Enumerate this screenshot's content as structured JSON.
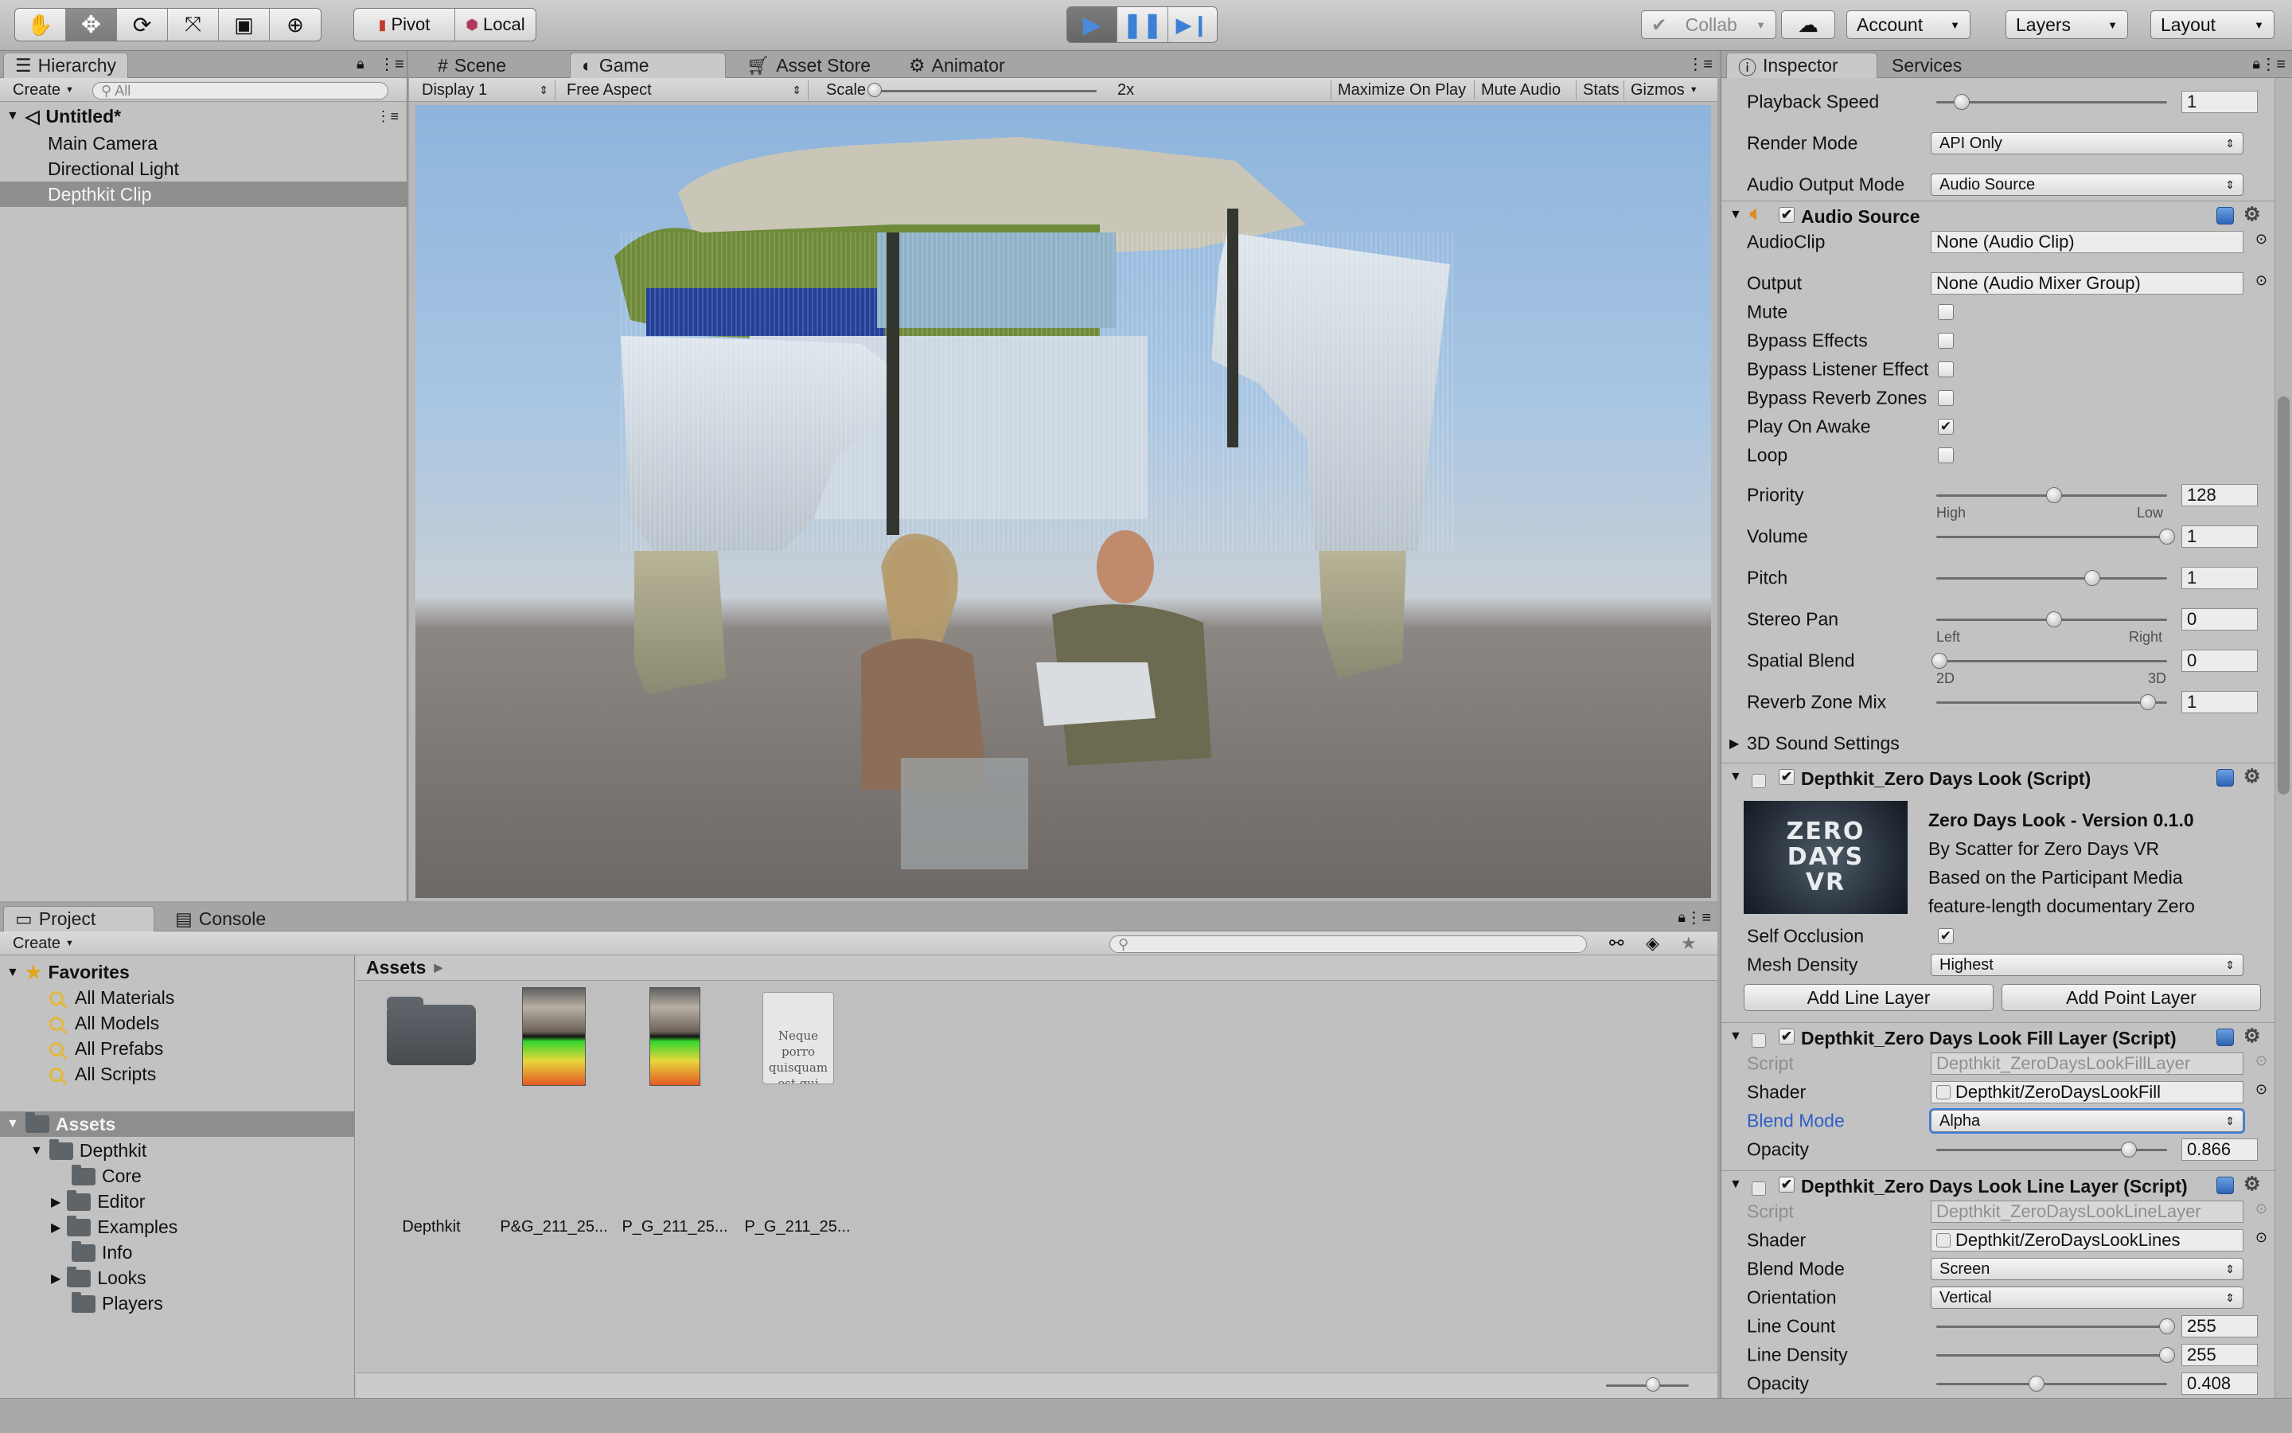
{
  "toolbar": {
    "pivot_label": "Pivot",
    "local_label": "Local",
    "collab_label": "Collab",
    "account_label": "Account",
    "layers_label": "Layers",
    "layout_label": "Layout"
  },
  "hierarchy": {
    "tab_label": "Hierarchy",
    "create_label": "Create",
    "search_placeholder": "All",
    "scene_name": "Untitled*",
    "items": [
      "Main Camera",
      "Directional Light",
      "Depthkit Clip"
    ],
    "selected_item": "Depthkit Clip"
  },
  "center_tabs": {
    "scene": "Scene",
    "game": "Game",
    "asset_store": "Asset Store",
    "animator": "Animator"
  },
  "game_toolbar": {
    "display": "Display 1",
    "aspect": "Free Aspect",
    "scale_label": "Scale",
    "scale_value": "2x",
    "maximize_on_play": "Maximize On Play",
    "mute_audio": "Mute Audio",
    "stats": "Stats",
    "gizmos": "Gizmos"
  },
  "project": {
    "tab_label": "Project",
    "console_label": "Console",
    "create_label": "Create",
    "favorites_label": "Favorites",
    "favorites": [
      "All Materials",
      "All Models",
      "All Prefabs",
      "All Scripts"
    ],
    "assets_label": "Assets",
    "tree": {
      "depthkit": "Depthkit",
      "children": [
        "Core",
        "Editor",
        "Examples",
        "Info",
        "Looks",
        "Players"
      ]
    },
    "breadcrumb": "Assets",
    "files": [
      "Depthkit",
      "P&G_211_25...",
      "P_G_211_25...",
      "P_G_211_25..."
    ],
    "doc_preview_text": "Neque porro quisquam est qui dolorem."
  },
  "inspector": {
    "tab_label": "Inspector",
    "services_label": "Services",
    "player": {
      "playback_speed_label": "Playback Speed",
      "playback_speed_value": "1",
      "render_mode_label": "Render Mode",
      "render_mode_value": "API Only",
      "audio_output_mode_label": "Audio Output Mode",
      "audio_output_mode_value": "Audio Source"
    },
    "audio_source": {
      "title": "Audio Source",
      "audioclip_label": "AudioClip",
      "audioclip_value": "None (Audio Clip)",
      "output_label": "Output",
      "output_value": "None (Audio Mixer Group)",
      "mute_label": "Mute",
      "bypass_effects_label": "Bypass Effects",
      "bypass_listener_label": "Bypass Listener Effect",
      "bypass_reverb_label": "Bypass Reverb Zones",
      "play_on_awake_label": "Play On Awake",
      "loop_label": "Loop",
      "priority_label": "Priority",
      "priority_value": "128",
      "priority_min": "High",
      "priority_max": "Low",
      "volume_label": "Volume",
      "volume_value": "1",
      "pitch_label": "Pitch",
      "pitch_value": "1",
      "stereo_pan_label": "Stereo Pan",
      "stereo_pan_value": "0",
      "stereo_min": "Left",
      "stereo_max": "Right",
      "spatial_blend_label": "Spatial Blend",
      "spatial_blend_value": "0",
      "spatial_min": "2D",
      "spatial_max": "3D",
      "reverb_zone_mix_label": "Reverb Zone Mix",
      "reverb_zone_mix_value": "1",
      "sound_settings_label": "3D Sound Settings"
    },
    "look": {
      "title": "Depthkit_Zero Days Look (Script)",
      "logo_text": "ZERO DAYS VR",
      "heading": "Zero Days Look - Version 0.1.0",
      "line1": "By Scatter for Zero Days VR",
      "line2": "Based on the Participant Media",
      "line3": "feature-length documentary Zero",
      "self_occlusion_label": "Self Occlusion",
      "mesh_density_label": "Mesh Density",
      "mesh_density_value": "Highest",
      "add_line_layer": "Add Line Layer",
      "add_point_layer": "Add Point Layer"
    },
    "fill_layer": {
      "title": "Depthkit_Zero Days Look Fill Layer (Script)",
      "script_label": "Script",
      "script_value": "Depthkit_ZeroDaysLookFillLayer",
      "shader_label": "Shader",
      "shader_value": "Depthkit/ZeroDaysLookFill",
      "blend_mode_label": "Blend Mode",
      "blend_mode_value": "Alpha",
      "opacity_label": "Opacity",
      "opacity_value": "0.866"
    },
    "line_layer": {
      "title": "Depthkit_Zero Days Look Line Layer (Script)",
      "script_label": "Script",
      "script_value": "Depthkit_ZeroDaysLookLineLayer",
      "shader_label": "Shader",
      "shader_value": "Depthkit/ZeroDaysLookLines",
      "blend_mode_label": "Blend Mode",
      "blend_mode_value": "Screen",
      "orientation_label": "Orientation",
      "orientation_value": "Vertical",
      "line_count_label": "Line Count",
      "line_count_value": "255",
      "line_density_label": "Line Density",
      "line_density_value": "255",
      "opacity_label": "Opacity",
      "opacity_value": "0.408"
    }
  },
  "colors": {
    "accent_blue": "#3d7ce0",
    "play_active": "#4a89dc",
    "selection": "#8e8e8e"
  }
}
